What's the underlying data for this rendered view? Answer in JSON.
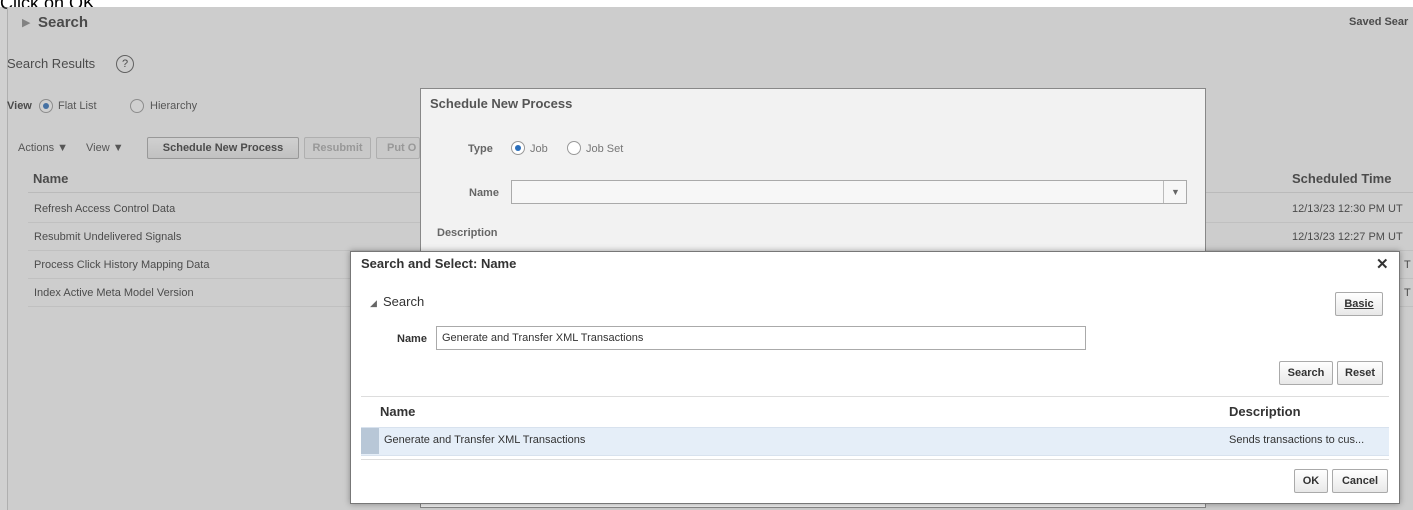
{
  "caption": "Click on OK.",
  "background": {
    "search_header": "Search",
    "saved_search_label": "Saved Sear",
    "search_results_label": "Search Results",
    "help_glyph": "?",
    "view_label": "View",
    "view_options": [
      "Flat List",
      "Hierarchy"
    ],
    "toolbar": {
      "actions_label": "Actions",
      "view_menu_label": "View",
      "schedule_button": "Schedule New Process",
      "resubmit_button": "Resubmit",
      "put_on_hold_button": "Put O"
    },
    "table": {
      "columns": [
        "Name",
        "Scheduled Time"
      ],
      "rows": [
        {
          "name": "Refresh Access Control Data",
          "time": "12/13/23 12:30 PM UT"
        },
        {
          "name": "Resubmit Undelivered Signals",
          "time": "12/13/23 12:27 PM UT"
        },
        {
          "name": "Process Click History Mapping Data",
          "time": "T"
        },
        {
          "name": "Index Active Meta Model Version",
          "time": "T"
        }
      ]
    }
  },
  "schedule_dialog": {
    "title": "Schedule New Process",
    "type_label": "Type",
    "type_options": [
      "Job",
      "Job Set"
    ],
    "name_label": "Name",
    "name_value": "",
    "description_label": "Description"
  },
  "search_select_dialog": {
    "title": "Search and Select: Name",
    "close_glyph": "✕",
    "search_section_label": "Search",
    "basic_button": "Basic",
    "name_label": "Name",
    "name_value": "Generate and Transfer XML Transactions",
    "search_button": "Search",
    "reset_button": "Reset",
    "results": {
      "columns": [
        "Name",
        "Description"
      ],
      "rows": [
        {
          "name": "Generate and Transfer XML Transactions",
          "description": "Sends transactions to cus..."
        }
      ]
    },
    "ok_button": "OK",
    "cancel_button": "Cancel"
  },
  "colors": {
    "selected_row": "#e5eef8",
    "radio_selected": "#2a6ebb",
    "overlay": "#787878"
  }
}
